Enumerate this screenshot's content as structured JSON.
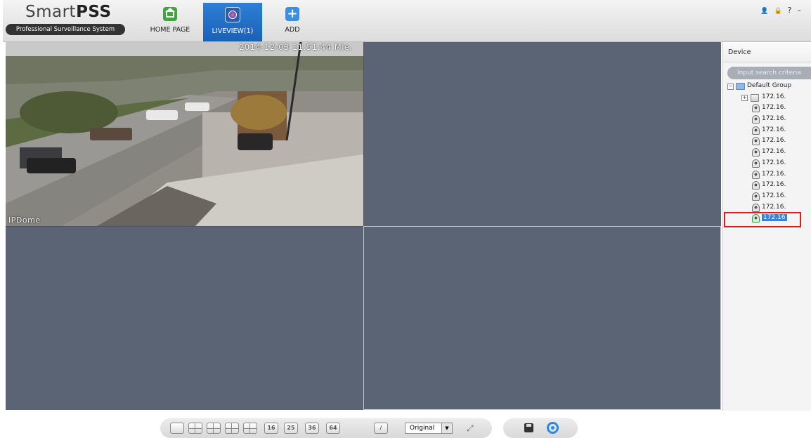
{
  "app": {
    "logo_title_light": "Smart",
    "logo_title_bold": "PSS",
    "logo_subtitle": "Professional Surveillance System"
  },
  "tabs": [
    {
      "label": "HOME PAGE",
      "icon": "home-icon",
      "color": "#3fa53f"
    },
    {
      "label": "LIVEVIEW(1)",
      "icon": "liveview-icon",
      "active": true,
      "color": "#1f6cc4"
    },
    {
      "label": "ADD",
      "icon": "plus-icon",
      "color": "#3c8fe0"
    }
  ],
  "top_icons": {
    "user": "👤",
    "lock": "🔒",
    "help": "?",
    "minimize": "–"
  },
  "camera": {
    "timestamp": "2014-12-03 11:51:44 Mie.",
    "name": "IPDome"
  },
  "device_panel": {
    "title": "Device",
    "search_placeholder": "Input search criteria",
    "group": "Default Group",
    "device": "172.16.",
    "channels": [
      "172.16.",
      "172.16.",
      "172.16.",
      "172.16.",
      "172.16.",
      "172.16.",
      "172.16.",
      "172.16.",
      "172.16.",
      "172.16."
    ],
    "selected_channel": "172.16"
  },
  "toolbar": {
    "layouts": [
      "1",
      "4",
      "6",
      "8",
      "9",
      "16",
      "25",
      "36",
      "64"
    ],
    "stream_select": "Original",
    "stream_arrow": "▼",
    "fullscreen": "⤢"
  },
  "colors": {
    "pane": "#5a6474",
    "accent": "#1f6cc4",
    "highlight": "#d62020"
  }
}
